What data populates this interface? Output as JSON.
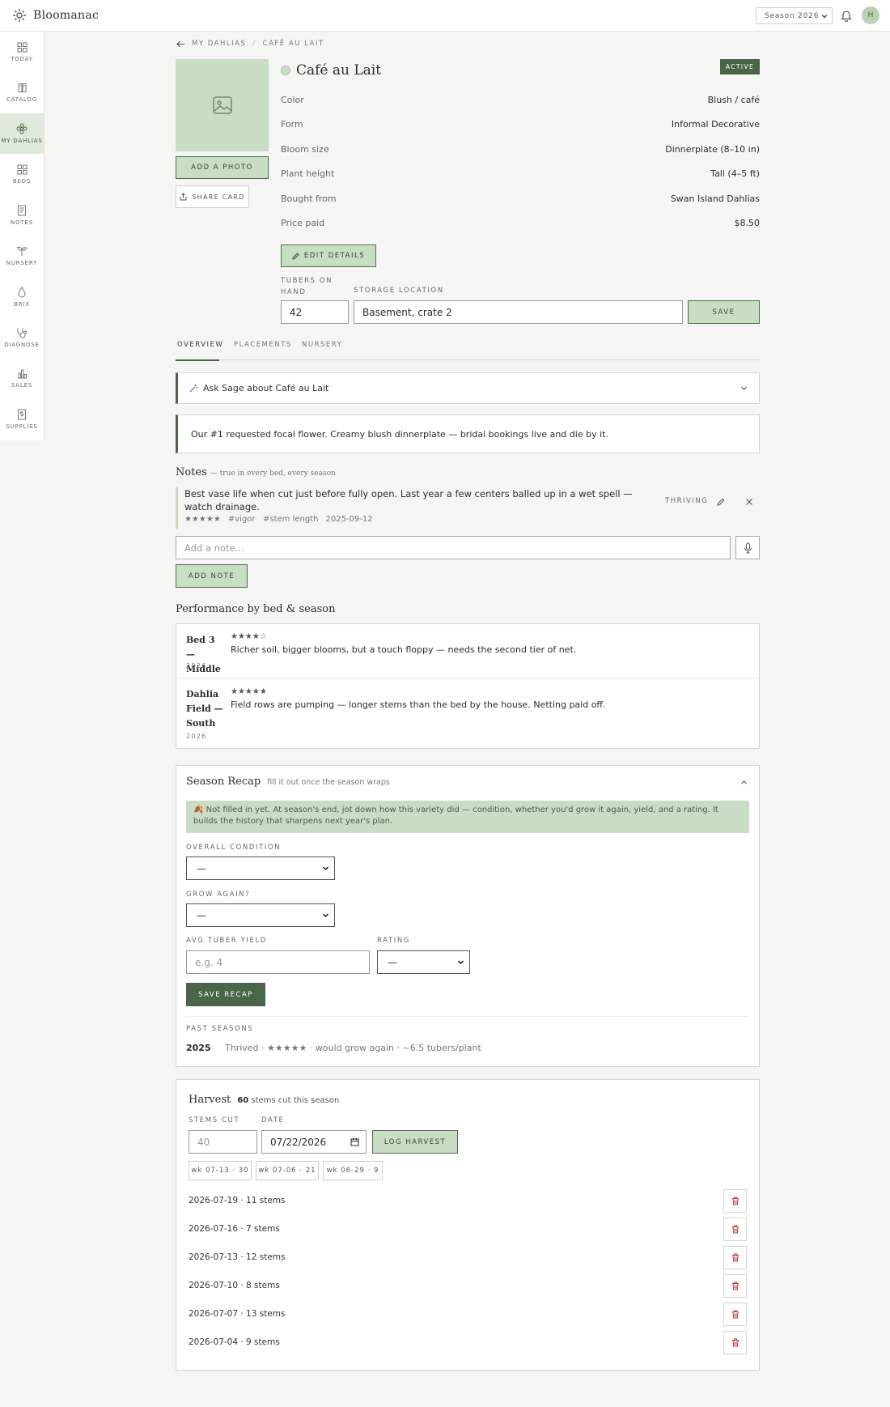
{
  "app": {
    "name": "Bloomanac",
    "season": "Season 2026",
    "user_initial": "H"
  },
  "colors": {
    "accent": "#4b6548",
    "sage": "#c9dcc4",
    "active_nav_bg": "#dfe9db",
    "delete": "#b33a3a"
  },
  "sidebar": {
    "items": [
      {
        "label": "TODAY",
        "icon": "grid-icon"
      },
      {
        "label": "CATALOG",
        "icon": "book-icon"
      },
      {
        "label": "MY DAHLIAS",
        "icon": "flower-icon",
        "active": true
      },
      {
        "label": "BEDS",
        "icon": "beds-grid-icon"
      },
      {
        "label": "NOTES",
        "icon": "note-icon"
      },
      {
        "label": "NURSERY",
        "icon": "sprout-icon"
      },
      {
        "label": "BRIX",
        "icon": "drop-icon"
      },
      {
        "label": "DIAGNOSE",
        "icon": "stethoscope-icon"
      },
      {
        "label": "SALES",
        "icon": "bar-chart-icon"
      },
      {
        "label": "SUPPLIES",
        "icon": "dollar-doc-icon"
      }
    ]
  },
  "breadcrumb": {
    "parent": "MY DAHLIAS",
    "sep": "/",
    "current": "CAFÉ AU LAIT"
  },
  "variety": {
    "name": "Café au Lait",
    "status": "ACTIVE",
    "add_photo": "ADD A PHOTO",
    "share_card": "SHARE CARD",
    "attributes": [
      {
        "label": "Color",
        "value": "Blush / café"
      },
      {
        "label": "Form",
        "value": "Informal Decorative"
      },
      {
        "label": "Bloom size",
        "value": "Dinnerplate (8–10 in)"
      },
      {
        "label": "Plant height",
        "value": "Tall (4–5 ft)"
      },
      {
        "label": "Bought from",
        "value": "Swan Island Dahlias"
      },
      {
        "label": "Price paid",
        "value": "$8.50"
      }
    ],
    "edit_details": "EDIT DETAILS",
    "tubers_label_1": "TUBERS ON",
    "tubers_label_2": "HAND",
    "tubers_value": "42",
    "storage_label": "STORAGE LOCATION",
    "storage_value": "Basement, crate 2",
    "save": "SAVE"
  },
  "tabs": [
    "OVERVIEW",
    "PLACEMENTS",
    "NURSERY"
  ],
  "ask_sage": "Ask Sage about Café au Lait",
  "description": "Our #1 requested focal flower. Creamy blush dinnerplate — bridal bookings live and die by it.",
  "notes": {
    "title": "Notes",
    "subtitle": "— true in every bed, every season",
    "items": [
      {
        "text": "Best vase life when cut just before fully open. Last year a few centers balled up in a wet spell — watch drainage.",
        "stars": "★★★★★",
        "tags": "#vigor   #stem length",
        "date": "2025-09-12",
        "status": "THRIVING"
      }
    ],
    "placeholder": "Add a note...",
    "add": "ADD NOTE"
  },
  "performance": {
    "title": "Performance by bed & season",
    "rows": [
      {
        "bed": "Bed 3 — Middle",
        "year": "2026",
        "stars": "★★★★☆",
        "text": "Richer soil, bigger blooms, but a touch floppy — needs the second tier of net."
      },
      {
        "bed": "Dahlia Field — South",
        "year": "2026",
        "stars": "★★★★★",
        "text": "Field rows are pumping — longer stems than the bed by the house. Netting paid off."
      }
    ]
  },
  "recap": {
    "title": "Season Recap",
    "subtitle": "fill it out once the season wraps",
    "notice": "🍂 Not filled in yet. At season's end, jot down how this variety did — condition, whether you'd grow it again, yield, and a rating. It builds the history that sharpens next year's plan.",
    "overall_label": "OVERALL CONDITION",
    "overall_value": "—",
    "grow_label": "GROW AGAIN?",
    "grow_value": "—",
    "yield_label": "AVG TUBER YIELD",
    "yield_placeholder": "e.g. 4",
    "rating_label": "RATING",
    "rating_value": "—",
    "save": "SAVE RECAP",
    "past_label": "PAST SEASONS",
    "past": [
      {
        "year": "2025",
        "text": "Thrived · ★★★★★ · would grow again · ~6.5 tubers/plant"
      }
    ]
  },
  "harvest": {
    "title": "Harvest",
    "count": "60",
    "count_suffix": "stems cut this season",
    "stems_label": "STEMS CUT",
    "stems_placeholder": "40",
    "date_label": "DATE",
    "date_value": "07/22/2026",
    "log": "LOG HARVEST",
    "chips": [
      "wk 07-13 · 30",
      "wk 07-06 · 21",
      "wk 06-29 · 9"
    ],
    "entries": [
      "2026-07-19 · 11 stems",
      "2026-07-16 · 7 stems",
      "2026-07-13 · 12 stems",
      "2026-07-10 · 8 stems",
      "2026-07-07 · 13 stems",
      "2026-07-04 · 9 stems"
    ]
  }
}
